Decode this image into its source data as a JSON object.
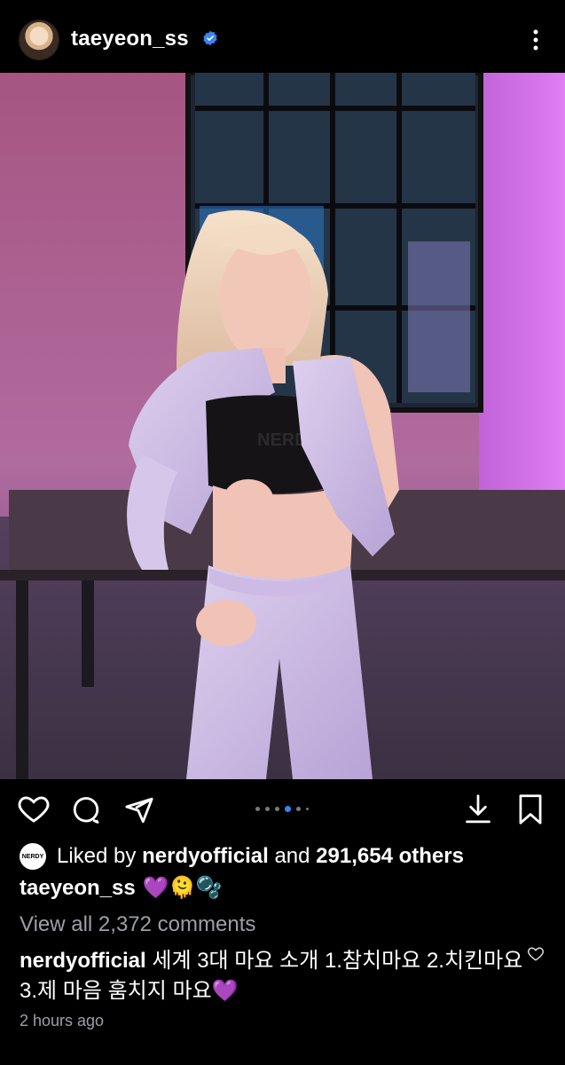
{
  "header": {
    "username": "taeyeon_ss",
    "verified": true,
    "more_icon": "more-vertical-icon"
  },
  "post": {
    "image_description": "",
    "carousel": {
      "count": 6,
      "active_index": 3
    }
  },
  "actions": {
    "like_icon": "heart-icon",
    "comment_icon": "comment-icon",
    "share_icon": "share-icon",
    "download_icon": "download-icon",
    "save_icon": "bookmark-icon"
  },
  "likes": {
    "brand_badge": "NERDY",
    "prefix": "Liked by",
    "liker": "nerdyofficial",
    "and": "and",
    "count": "291,654 others"
  },
  "caption": {
    "username": "taeyeon_ss",
    "emojis": "💜🫠🫧"
  },
  "comments": {
    "view_all": "View all 2,372 comments",
    "top_comment": {
      "username": "nerdyofficial",
      "text": "세계 3대 마요 소개 1.참치마요 2.치킨마요 3.제 마음 훔치지 마요💜"
    }
  },
  "timestamp": "2 hours ago",
  "colors": {
    "background": "#000000",
    "verified": "#3b82f6",
    "active_dot": "#3b82f6",
    "muted_text": "#9aa0a6"
  }
}
